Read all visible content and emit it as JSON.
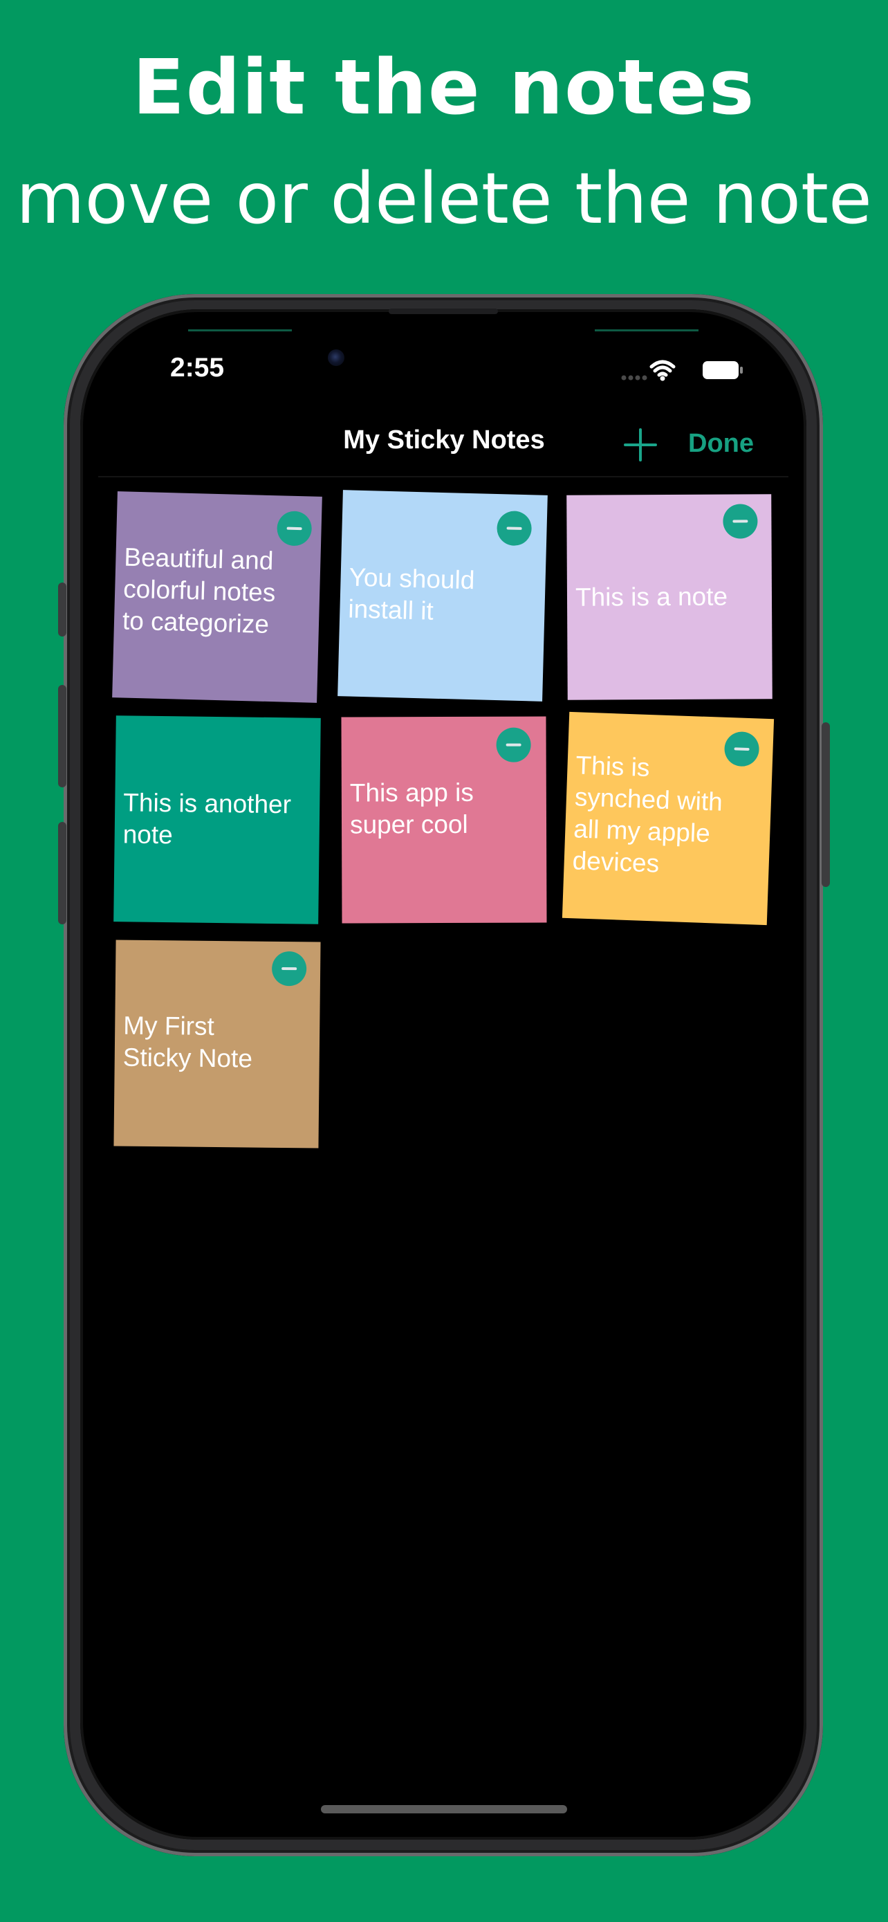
{
  "promo": {
    "title": "Edit the notes",
    "subtitle": "move or delete the note",
    "background": "#029960"
  },
  "status_bar": {
    "time": "2:55",
    "icons": [
      "signal-dots-icon",
      "wifi-icon",
      "battery-icon"
    ]
  },
  "nav": {
    "title": "My Sticky Notes",
    "add_icon": "plus-icon",
    "done_label": "Done",
    "accent": "#17a182"
  },
  "notes": [
    {
      "text": "Beautiful and\ncolorful notes\nto categorize",
      "color": "#9680b2",
      "has_delete": true
    },
    {
      "text": "You should\ninstall it",
      "color": "#b2d8f8",
      "has_delete": true
    },
    {
      "text": "This is a note",
      "color": "#dfbce4",
      "has_delete": true
    },
    {
      "text": "This is another\nnote",
      "color": "#009e82",
      "has_delete": false
    },
    {
      "text": "This app is\nsuper cool",
      "color": "#e07894",
      "has_delete": true
    },
    {
      "text": "This is\nsynched with\nall my apple\ndevices",
      "color": "#fec75c",
      "has_delete": true
    },
    {
      "text": "My First\nSticky Note",
      "color": "#c49c6c",
      "has_delete": true
    }
  ]
}
